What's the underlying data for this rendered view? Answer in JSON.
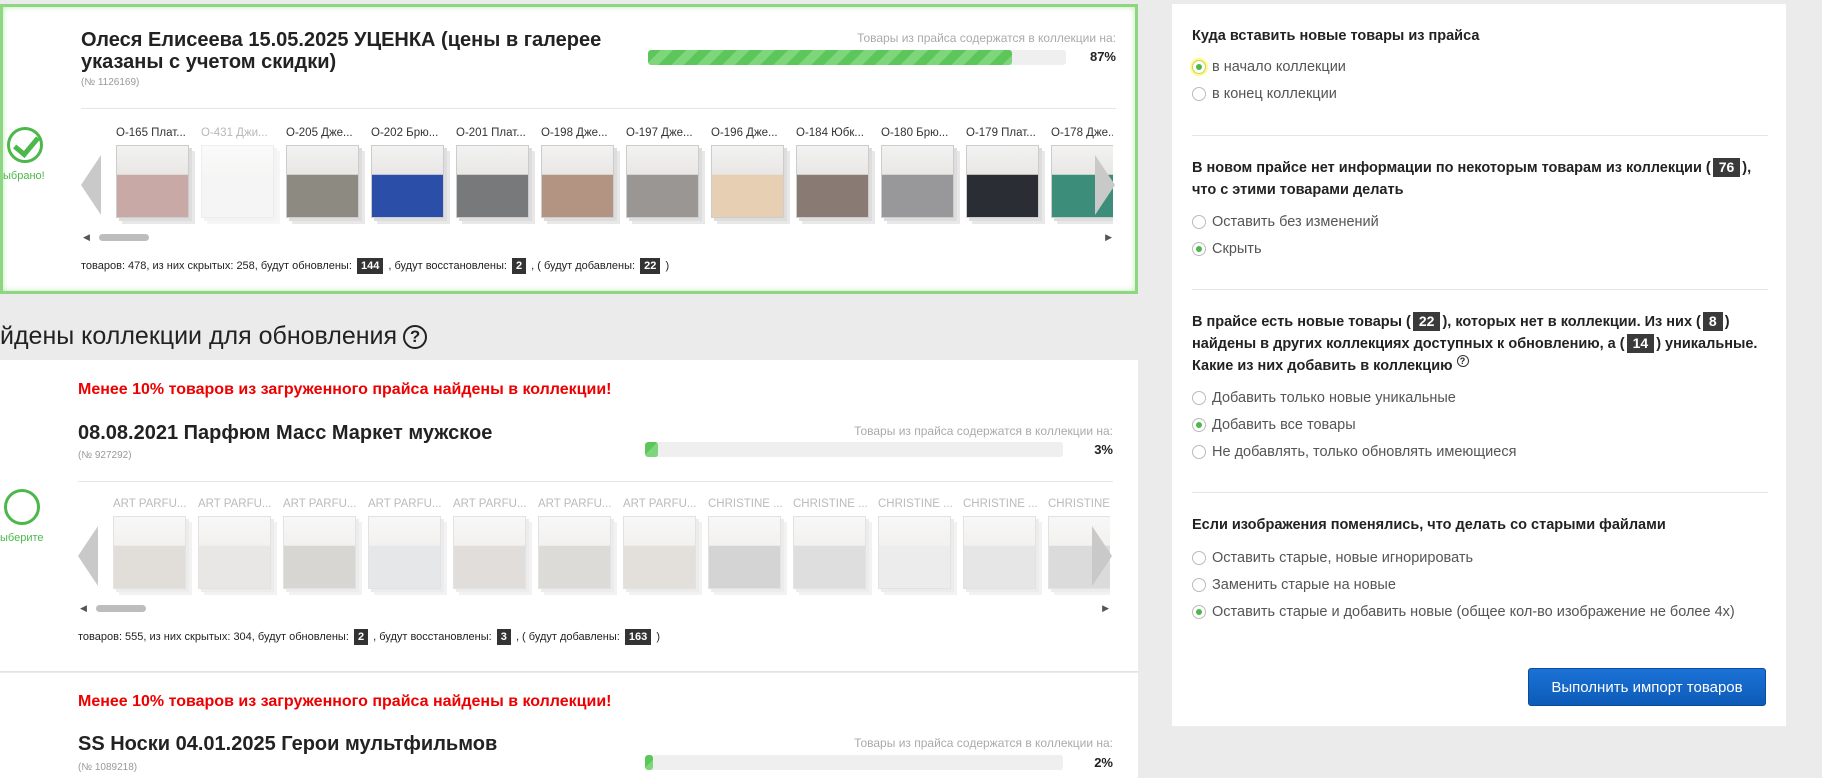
{
  "card1": {
    "title": "Олеся Елисеева 15.05.2025 УЦЕНКА (цены в галерее указаны с учетом скидки)",
    "number": "(№ 1126169)",
    "progress_label": "Товары из прайса содержатся в коллекции на:",
    "progress_value": 87,
    "progress_text": "87%",
    "selected_label": "ыбрано!",
    "thumbs": [
      {
        "label": "О-165 Плат...",
        "faded": false,
        "color": "#c9a9a6"
      },
      {
        "label": "О-431 Джи...",
        "faded": true,
        "color": "#e4e4e4"
      },
      {
        "label": "О-205 Дже...",
        "faded": false,
        "color": "#8d8a82"
      },
      {
        "label": "О-202 Брю...",
        "faded": false,
        "color": "#2b4fa8"
      },
      {
        "label": "О-201 Плат...",
        "faded": false,
        "color": "#78797a"
      },
      {
        "label": "О-198 Дже...",
        "faded": false,
        "color": "#b39482"
      },
      {
        "label": "О-197 Дже...",
        "faded": false,
        "color": "#9a9693"
      },
      {
        "label": "О-196 Дже...",
        "faded": false,
        "color": "#e6cfb3"
      },
      {
        "label": "О-184 Юбк...",
        "faded": false,
        "color": "#8a7a74"
      },
      {
        "label": "О-180 Брю...",
        "faded": false,
        "color": "#98989b"
      },
      {
        "label": "О-179 Плат...",
        "faded": false,
        "color": "#2b2d35"
      },
      {
        "label": "О-178 Дже...",
        "faded": false,
        "color": "#3c8e7a"
      }
    ],
    "stats": {
      "prefix": "товаров: 478, из них скрытых: 258, будут обновлены:",
      "updated": "144",
      "mid": ", будут восстановлены:",
      "restored": "2",
      "mid2": ", ( будут добавлены:",
      "added": "22",
      "suffix": ")"
    }
  },
  "section": {
    "title": "йдены коллекции для обновления"
  },
  "card2": {
    "warning": "Менее 10% товаров из загруженного прайса найдены в коллекции!",
    "title": "08.08.2021 Парфюм Масс Маркет мужское",
    "number": "(№ 927292)",
    "progress_label": "Товары из прайса содержатся в коллекции на:",
    "progress_value": 3,
    "progress_text": "3%",
    "select_label": "ыберите",
    "thumbs": [
      {
        "label": "ART PARFU...",
        "color": "#c9c4bd"
      },
      {
        "label": "ART PARFU...",
        "color": "#d7d4d0"
      },
      {
        "label": "ART PARFU...",
        "color": "#bab5b0"
      },
      {
        "label": "ART PARFU...",
        "color": "#d0d4d8"
      },
      {
        "label": "ART PARFU...",
        "color": "#c7c2bc"
      },
      {
        "label": "ART PARFU...",
        "color": "#c2bfb8"
      },
      {
        "label": "ART PARFU...",
        "color": "#cdc7be"
      },
      {
        "label": "CHRISTINE ...",
        "color": "#b1b1b1"
      },
      {
        "label": "CHRISTINE ...",
        "color": "#c4c4c4"
      },
      {
        "label": "CHRISTINE ...",
        "color": "#dedede"
      },
      {
        "label": "CHRISTINE ...",
        "color": "#d2d2d2"
      },
      {
        "label": "CHRISTINE ...",
        "color": "#bfbfbf"
      }
    ],
    "stats": {
      "prefix": "товаров: 555, из них скрытых: 304, будут обновлены:",
      "updated": "2",
      "mid": ", будут восстановлены:",
      "restored": "3",
      "mid2": ", ( будут добавлены:",
      "added": "163",
      "suffix": ")"
    }
  },
  "card3": {
    "warning": "Менее 10% товаров из загруженного прайса найдены в коллекции!",
    "title": "SS Носки 04.01.2025 Герои мультфильмов",
    "number": "(№ 1089218)",
    "progress_label": "Товары из прайса содержатся в коллекции на:",
    "progress_value": 2,
    "progress_text": "2%"
  },
  "panel": {
    "q1": "Куда вставить новые товары из прайса",
    "q1_options": [
      "в начало коллекции",
      "в конец коллекции"
    ],
    "q1_selected": 0,
    "q2_a": "В новом прайсе нет информации по некоторым товарам из коллекции (",
    "q2_count": "76",
    "q2_b": "), что с этими товарами делать",
    "q2_options": [
      "Оставить без изменений",
      "Скрыть"
    ],
    "q2_selected": 1,
    "q3_a": "В прайсе есть новые товары (",
    "q3_new": "22",
    "q3_b": "), которых нет в коллекции. Из них (",
    "q3_found": "8",
    "q3_c": ") найдены в других коллекциях доступных к обновлению, а (",
    "q3_unique": "14",
    "q3_d": ") уникальные. Какие из них добавить в коллекцию",
    "q3_options": [
      "Добавить только новые уникальные",
      "Добавить все товары",
      "Не добавлять, только обновлять имеющиеся"
    ],
    "q3_selected": 1,
    "q4": "Если изображения поменялись, что делать со старыми файлами",
    "q4_options": [
      "Оставить старые, новые игнорировать",
      "Заменить старые на новые",
      "Оставить старые и добавить новые (общее кол-во изображение не более 4х)"
    ],
    "q4_selected": 2,
    "import_button": "Выполнить импорт товаров"
  },
  "colors": {
    "accent": "#4cb84c",
    "warning": "#e00000",
    "button": "#0d5bb8"
  }
}
